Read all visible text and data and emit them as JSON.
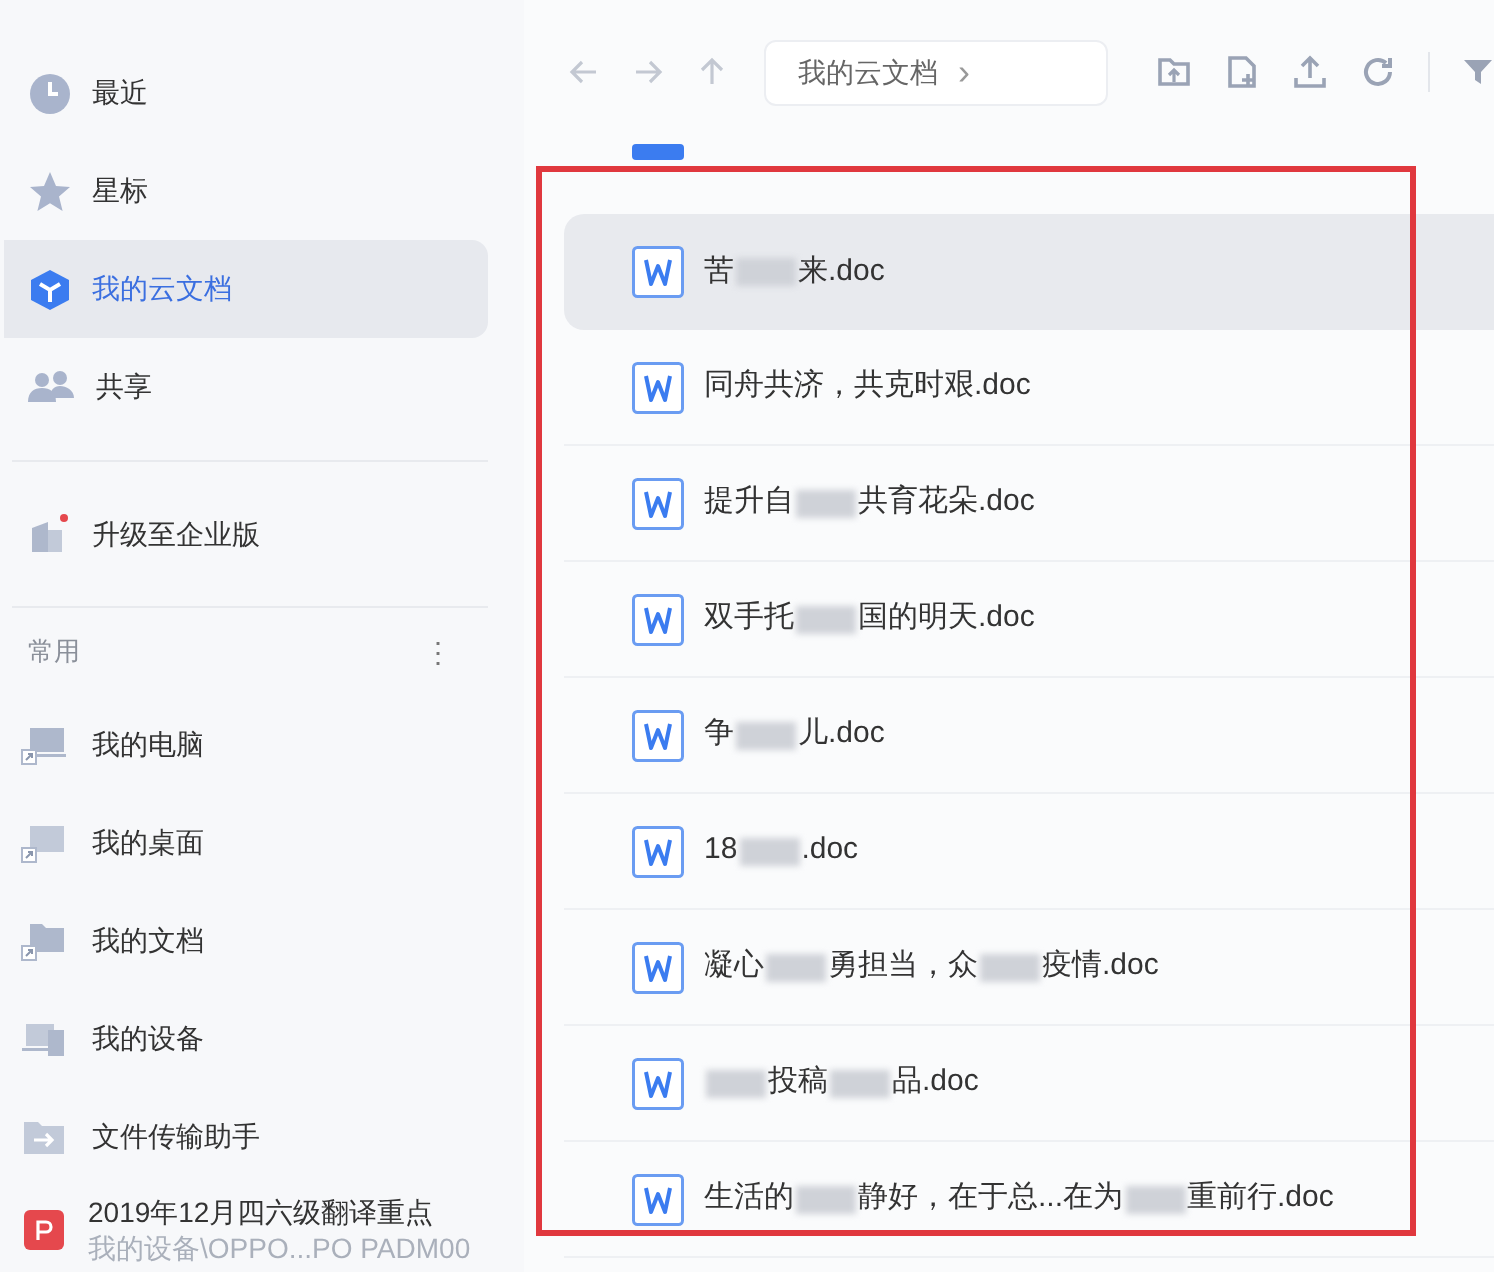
{
  "sidebar": {
    "nav": [
      {
        "label": "最近",
        "selected": false
      },
      {
        "label": "星标",
        "selected": false
      },
      {
        "label": "我的云文档",
        "selected": true
      },
      {
        "label": "共享",
        "selected": false
      }
    ],
    "upgrade": {
      "label": "升级至企业版",
      "badge": true
    },
    "section": {
      "title": "常用",
      "menu": "⋮"
    },
    "shortcuts": [
      {
        "label": "我的电脑"
      },
      {
        "label": "我的桌面"
      },
      {
        "label": "我的文档"
      },
      {
        "label": "我的设备"
      },
      {
        "label": "文件传输助手"
      }
    ],
    "recent_file": {
      "title": "2019年12月四六级翻译重点",
      "path": "我的设备\\OPPO...PO PADM00"
    }
  },
  "toolbar": {
    "breadcrumb": "我的云文档",
    "chevron": "›"
  },
  "files": [
    {
      "segments": [
        {
          "kind": "text",
          "text": "苦"
        },
        {
          "kind": "blur"
        },
        {
          "kind": "text",
          "text": "来.doc"
        }
      ],
      "selected": true
    },
    {
      "segments": [
        {
          "kind": "text",
          "text": "同舟共济，共克时艰.doc"
        }
      ],
      "selected": false
    },
    {
      "segments": [
        {
          "kind": "text",
          "text": "提升自"
        },
        {
          "kind": "blur"
        },
        {
          "kind": "text",
          "text": "共育花朵.doc"
        }
      ],
      "selected": false
    },
    {
      "segments": [
        {
          "kind": "text",
          "text": "双手托"
        },
        {
          "kind": "blur"
        },
        {
          "kind": "text",
          "text": "国的明天.doc"
        }
      ],
      "selected": false
    },
    {
      "segments": [
        {
          "kind": "text",
          "text": "争"
        },
        {
          "kind": "blur"
        },
        {
          "kind": "text",
          "text": "儿.doc"
        }
      ],
      "selected": false
    },
    {
      "segments": [
        {
          "kind": "text",
          "text": "18"
        },
        {
          "kind": "blur"
        },
        {
          "kind": "text",
          "text": ".doc"
        }
      ],
      "selected": false
    },
    {
      "segments": [
        {
          "kind": "text",
          "text": "凝心"
        },
        {
          "kind": "blur"
        },
        {
          "kind": "text",
          "text": "勇担当，众"
        },
        {
          "kind": "blur"
        },
        {
          "kind": "text",
          "text": "疫情.doc"
        }
      ],
      "selected": false
    },
    {
      "segments": [
        {
          "kind": "blur"
        },
        {
          "kind": "text",
          "text": "投稿"
        },
        {
          "kind": "blur"
        },
        {
          "kind": "text",
          "text": "品.doc"
        }
      ],
      "selected": false
    },
    {
      "segments": [
        {
          "kind": "text",
          "text": "生活的"
        },
        {
          "kind": "blur"
        },
        {
          "kind": "text",
          "text": "静好，在于总...在为"
        },
        {
          "kind": "blur"
        },
        {
          "kind": "text",
          "text": "重前行.doc"
        }
      ],
      "selected": false
    }
  ],
  "annotation": {
    "kind": "highlight-box"
  }
}
